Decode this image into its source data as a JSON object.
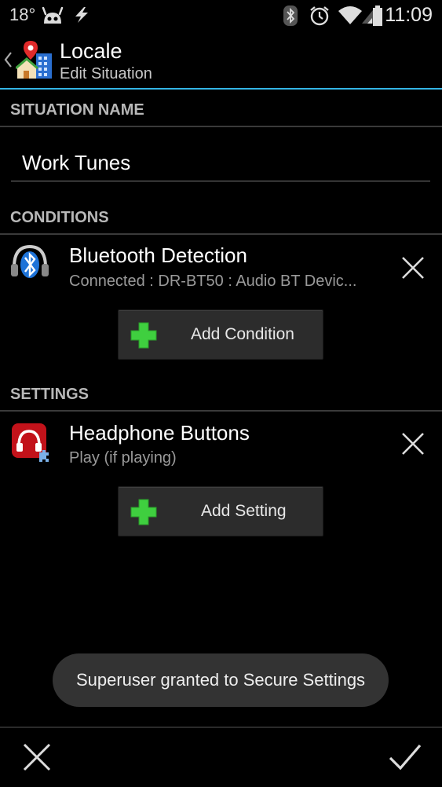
{
  "statusbar": {
    "temperature": "18°",
    "time": "11:09",
    "icons": [
      "cyanogen-android-icon",
      "flash-icon",
      "bluetooth-icon",
      "alarm-icon",
      "wifi-icon",
      "signal-icon",
      "battery-icon"
    ]
  },
  "actionbar": {
    "title": "Locale",
    "subtitle": "Edit Situation",
    "accent_color": "#33b5e5"
  },
  "situation_name": {
    "header": "SITUATION NAME",
    "value": "Work Tunes"
  },
  "conditions": {
    "header": "CONDITIONS",
    "items": [
      {
        "title": "Bluetooth Detection",
        "subtitle": "Connected : DR-BT50 : Audio BT Devic...",
        "icon": "bluetooth-headset-icon"
      }
    ],
    "add_label": "Add Condition"
  },
  "settings": {
    "header": "SETTINGS",
    "items": [
      {
        "title": "Headphone Buttons",
        "subtitle": "Play (if playing)",
        "icon": "headphone-plugin-icon"
      }
    ],
    "add_label": "Add Setting"
  },
  "toast": {
    "text": "Superuser granted to Secure Settings"
  },
  "bottombar": {
    "cancel_icon": "close-icon",
    "confirm_icon": "checkmark-icon"
  },
  "colors": {
    "add_plus": "#3fcf3f",
    "headphone_red": "#c2121a"
  }
}
